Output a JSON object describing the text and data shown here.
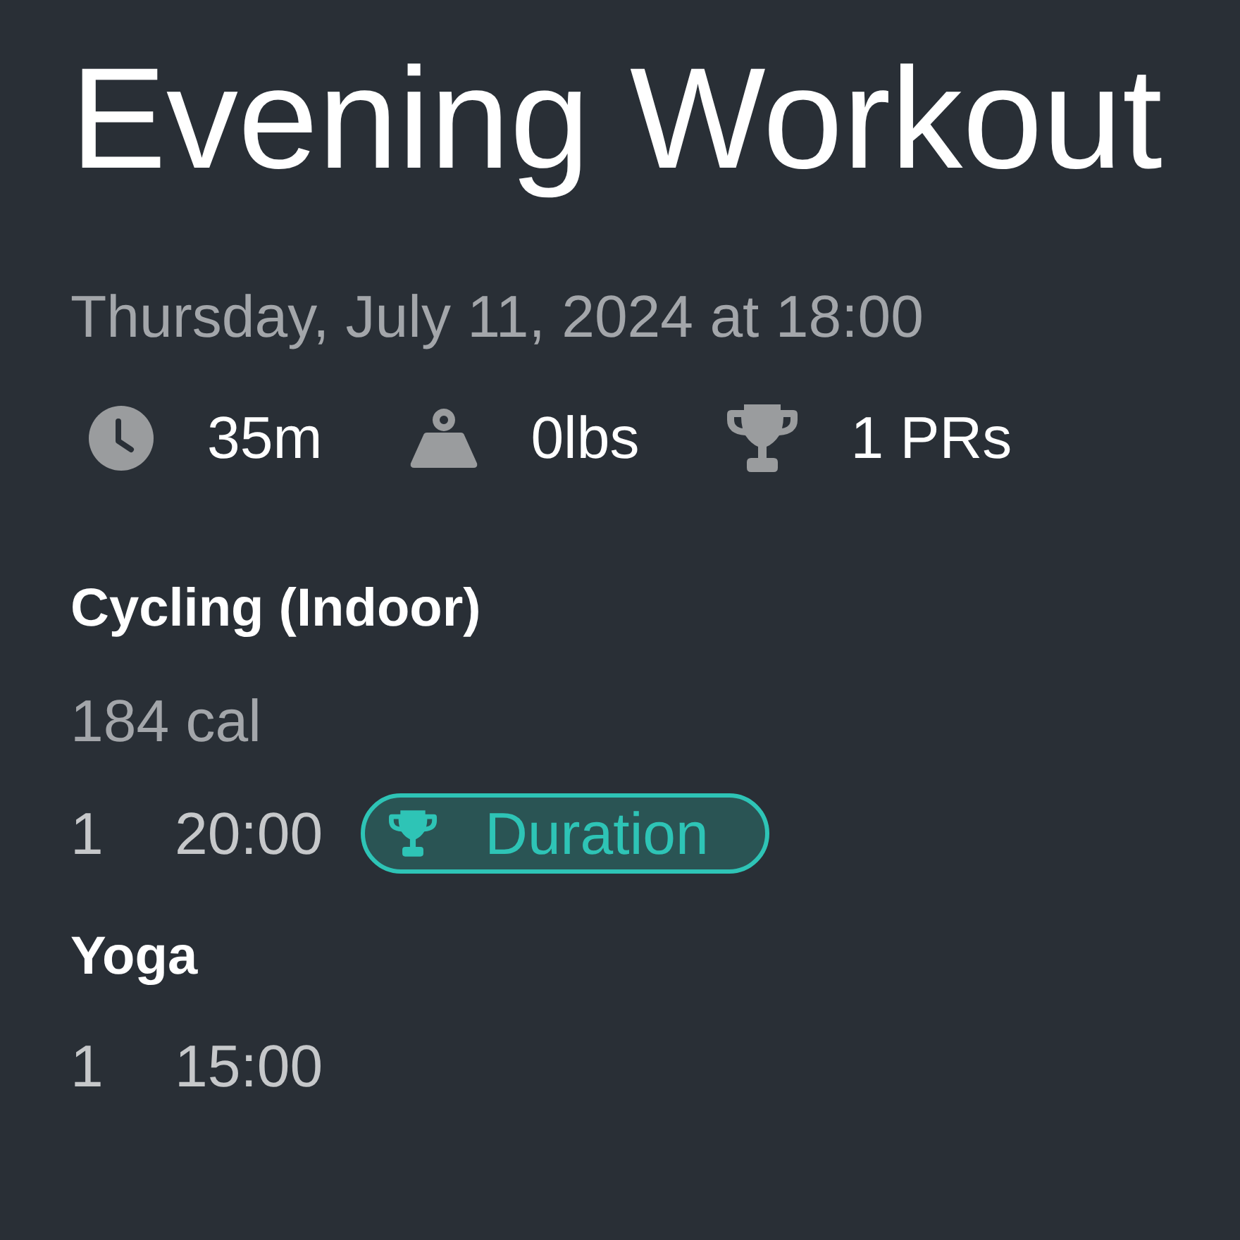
{
  "workout": {
    "title": "Evening Workout",
    "date": "Thursday, July 11, 2024 at 18:00"
  },
  "stats": [
    {
      "kind": "duration",
      "value": "35m"
    },
    {
      "kind": "weight",
      "value": "0lbs"
    },
    {
      "kind": "prs",
      "value": "1 PRs"
    }
  ],
  "exercises": [
    {
      "name": "Cycling (Indoor)",
      "calories": "184 cal",
      "sets": [
        {
          "number": "1",
          "value": "20:00",
          "badges": [
            {
              "label": "Duration"
            }
          ]
        }
      ]
    },
    {
      "name": "Yoga",
      "sets": [
        {
          "number": "1",
          "value": "15:00"
        }
      ]
    }
  ]
}
